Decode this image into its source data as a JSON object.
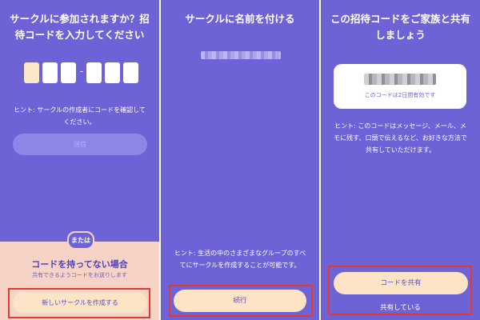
{
  "panel1": {
    "title": "サークルに参加されますか？招待コードを入力してください",
    "code_separator": "-",
    "hint": "ヒント: サークルの作成者にコードを確認してください。",
    "submit_label": "送信",
    "or_label": "または",
    "no_code_title": "コードを持ってない場合",
    "no_code_subtitle": "共有できるようコードをお送りします",
    "create_button_label": "新しいサークルを作成する"
  },
  "panel2": {
    "title": "サークルに名前を付ける",
    "hint": "ヒント: 生活の中のさまざまなグループのすべてにサークルを作成することが可能です。",
    "continue_label": "続行"
  },
  "panel3": {
    "title": "この招待コードをご家族と共有しましょう",
    "code_valid_text": "このコードは2日間有効です",
    "hint": "ヒント: このコードはメッセージ、メール、メモに残す、口頭で伝えるなど、お好きな方法で共有していただけます。",
    "share_button_label": "コードを共有",
    "shared_link_label": "共有している"
  },
  "colors": {
    "panel_bg": "#6e63d6",
    "button_bg": "#fde4c6",
    "bottom_area_bg": "#f6d3c4",
    "highlight": "#e23b2e"
  }
}
